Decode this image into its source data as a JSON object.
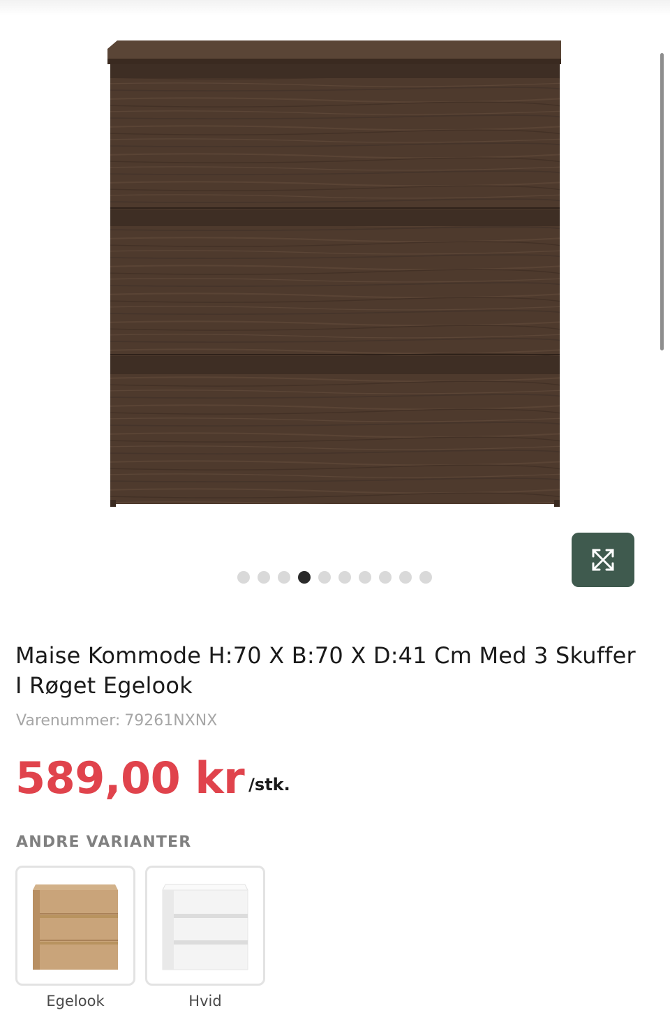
{
  "gallery": {
    "image_alt": "Maise Kommode røget egelook",
    "slide_count": 10,
    "active_slide": 4,
    "expand_icon": "expand-arrows-icon",
    "expand_button_color": "#3f5a4e"
  },
  "product": {
    "title": "Maise Kommode H:70 X B:70 X D:41 Cm Med 3 Skuffer I Røget Egelook",
    "sku_label": "Varenummer:",
    "sku_value": "79261NXNX",
    "price": "589,00 kr",
    "price_unit": "/stk.",
    "price_color": "#e0434c"
  },
  "variants": {
    "heading": "ANDRE VARIANTER",
    "items": [
      {
        "label": "Egelook",
        "color": "#c9a47a"
      },
      {
        "label": "Hvid",
        "color": "#f4f4f4"
      }
    ]
  }
}
